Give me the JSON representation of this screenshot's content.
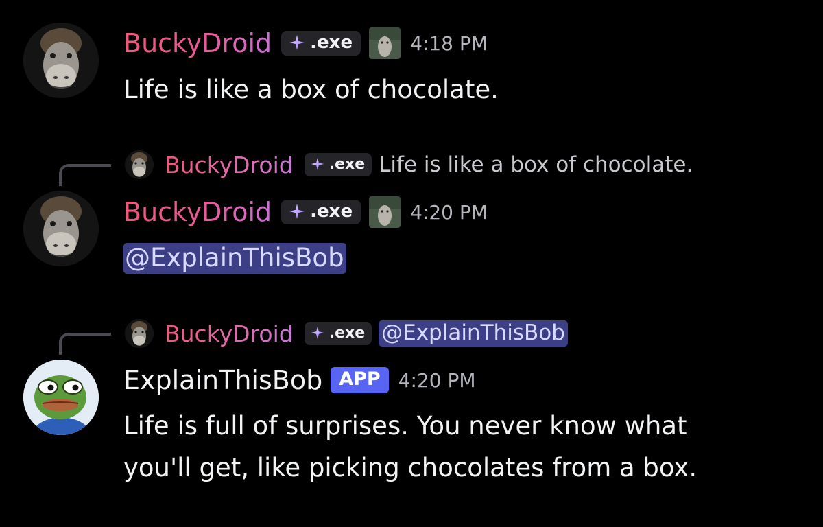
{
  "messages": [
    {
      "username": "BuckyDroid",
      "tag": ".exe",
      "time": "4:18 PM",
      "content": "Life is like a box of chocolate."
    },
    {
      "reply": {
        "username": "BuckyDroid",
        "tag": ".exe",
        "text": "Life is like a box of chocolate."
      },
      "username": "BuckyDroid",
      "tag": ".exe",
      "time": "4:20 PM",
      "mention": "@ExplainThisBob"
    },
    {
      "reply": {
        "username": "BuckyDroid",
        "tag": ".exe",
        "mention": "@ExplainThisBob"
      },
      "username": "ExplainThisBob",
      "badge": "APP",
      "time": "4:20 PM",
      "content_line1": "Life is full of surprises. You never know what",
      "content_line2": "you'll get, like picking chocolates from a box."
    }
  ],
  "colors": {
    "background": "#000000",
    "mention_bg": "#3d3f86",
    "app_badge": "#5865f2",
    "username_gradient_start": "#f0577a",
    "username_gradient_end": "#cf6fd9"
  },
  "icons": {
    "tag": "sparkle-diamond-icon",
    "role": "donkey-role-icon"
  }
}
